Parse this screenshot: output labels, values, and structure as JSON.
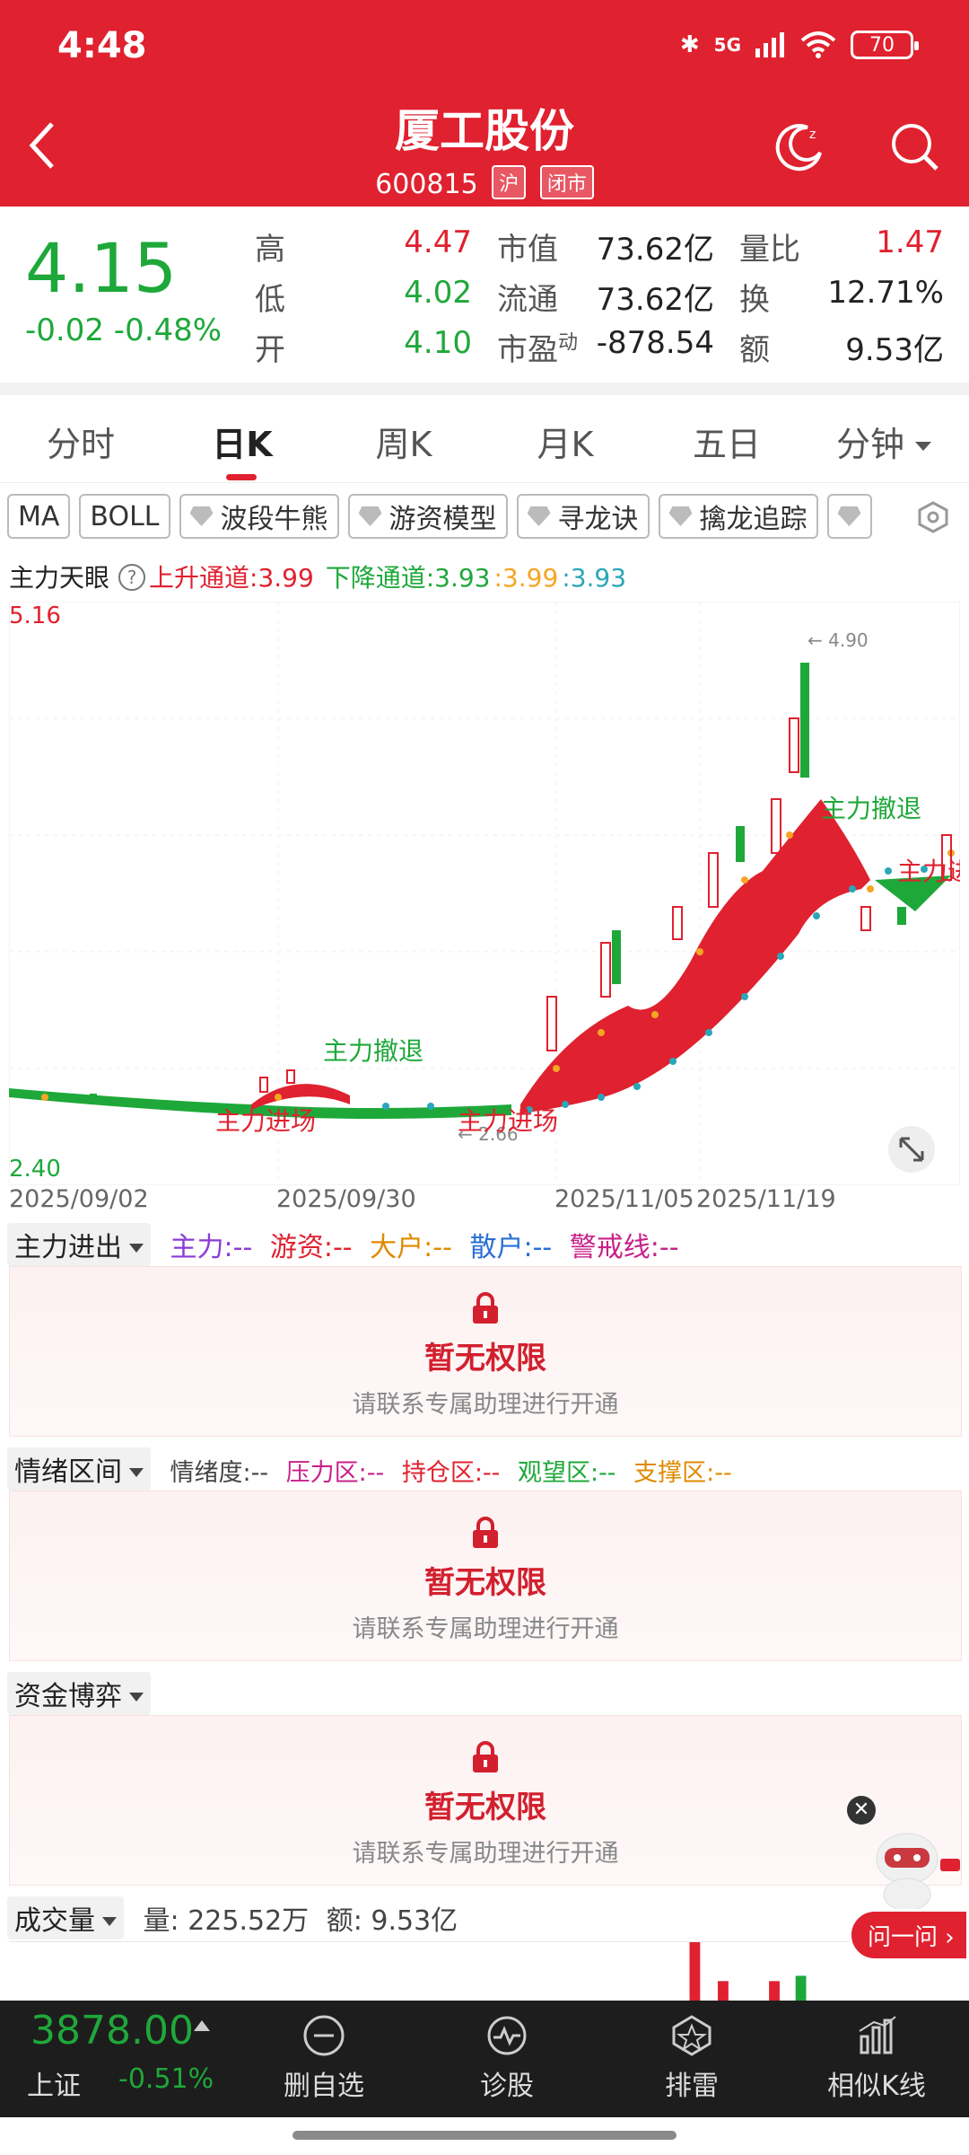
{
  "status_bar": {
    "time": "4:48",
    "network": "5G",
    "battery": "70"
  },
  "header": {
    "title": "厦工股份",
    "code": "600815",
    "exchange_tag": "沪",
    "status_tag": "闭市"
  },
  "quote": {
    "price": "4.15",
    "change": "-0.02",
    "change_pct": "-0.48%",
    "high_label": "高",
    "high": "4.47",
    "low_label": "低",
    "low": "4.02",
    "open_label": "开",
    "open": "4.10",
    "mktcap_label": "市值",
    "mktcap": "73.62亿",
    "float_label": "流通",
    "float": "73.62亿",
    "pe_label": "市盈",
    "pe_sup": "动",
    "pe": "-878.54",
    "volratio_label": "量比",
    "volratio": "1.47",
    "turnover_label": "换",
    "turnover": "12.71%",
    "amount_label": "额",
    "amount": "9.53亿"
  },
  "tabs": [
    "分时",
    "日K",
    "周K",
    "月K",
    "五日",
    "分钟"
  ],
  "active_tab": "日K",
  "chips": [
    "MA",
    "BOLL",
    "波段牛熊",
    "游资模型",
    "寻龙诀",
    "擒龙追踪"
  ],
  "indicator": {
    "name": "主力天眼",
    "up_channel": "上升通道:3.99",
    "down_channel": "下降通道:3.93",
    "v1": ":3.99",
    "v2": ":3.93"
  },
  "chart": {
    "y_max": "5.16",
    "y_min": "2.40",
    "peak": "← 4.90",
    "trough": "← 2.66",
    "dates": [
      "2025/09/02",
      "2025/09/30",
      "2025/11/05",
      "2025/11/19"
    ],
    "annotations": {
      "retreat": "主力撤退",
      "enter": "主力进场"
    },
    "colors": {
      "up": "#e0212f",
      "down": "#1ea83a",
      "channel_up": "#f5a623",
      "channel_down": "#2aa7b8"
    }
  },
  "panels": {
    "flow": {
      "dropdown": "主力进出",
      "items": [
        "主力:--",
        "游资:--",
        "大户:--",
        "散户:--",
        "警戒线:--"
      ]
    },
    "mood": {
      "dropdown": "情绪区间",
      "items": [
        "情绪度:--",
        "压力区:--",
        "持仓区:--",
        "观望区:--",
        "支撑区:--"
      ]
    },
    "game": {
      "dropdown": "资金博弈"
    },
    "volume": {
      "dropdown": "成交量",
      "vol": "量: 225.52万",
      "amt": "额: 9.53亿"
    },
    "locked_title": "暂无权限",
    "locked_sub": "请联系专属助理进行开通"
  },
  "assistant": {
    "ask_label": "问一问 ›"
  },
  "bottom_bar": {
    "index_value": "3878.00",
    "index_name": "上证",
    "index_pct": "-0.51%",
    "buttons": [
      "删自选",
      "诊股",
      "排雷",
      "相似K线"
    ]
  }
}
